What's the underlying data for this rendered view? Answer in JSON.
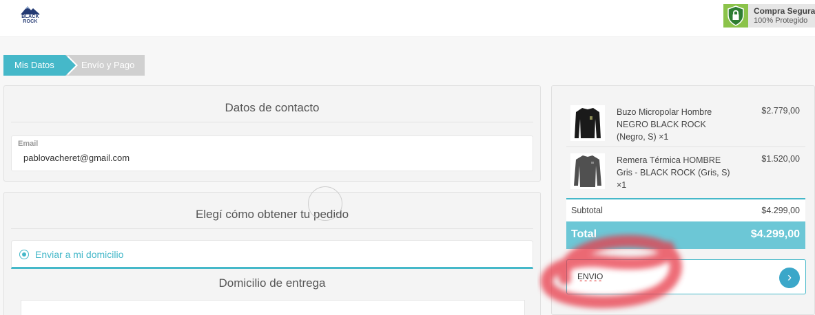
{
  "header": {
    "brand": [
      "BLACK",
      "ROCK"
    ],
    "secure_title": "Compra Segura",
    "secure_sub": "100% Protegido",
    "shield_color": "#8bc34a"
  },
  "steps": [
    {
      "label": "Mis Datos",
      "active": true
    },
    {
      "label": "Envío y Pago",
      "active": false
    }
  ],
  "contact": {
    "title": "Datos de contacto",
    "email_label": "Email",
    "email_value": "pablovacheret@gmail.com"
  },
  "shipping": {
    "title": "Elegí cómo obtener tu pedido",
    "option_label": "Enviar a mi domicilio",
    "address_title": "Domicilio de entrega"
  },
  "summary": {
    "items": [
      {
        "name": "Buzo Micropolar Hombre NEGRO BLACK ROCK (Negro, S) ×1",
        "price": "$2.779,00",
        "icon": "black-jacket-icon"
      },
      {
        "name": "Remera Térmica HOMBRE Gris - BLACK ROCK (Gris, S) ×1",
        "price": "$1.520,00",
        "icon": "gray-shirt-icon"
      }
    ],
    "subtotal_label": "Subtotal",
    "subtotal_value": "$4.299,00",
    "total_label": "Total",
    "total_value": "$4.299,00",
    "coupon_value": "ENVIO",
    "coupon_button": "›"
  },
  "colors": {
    "accent": "#45b8c9",
    "total_bg": "#6cc7d6",
    "annotation": "#e83a4a"
  }
}
